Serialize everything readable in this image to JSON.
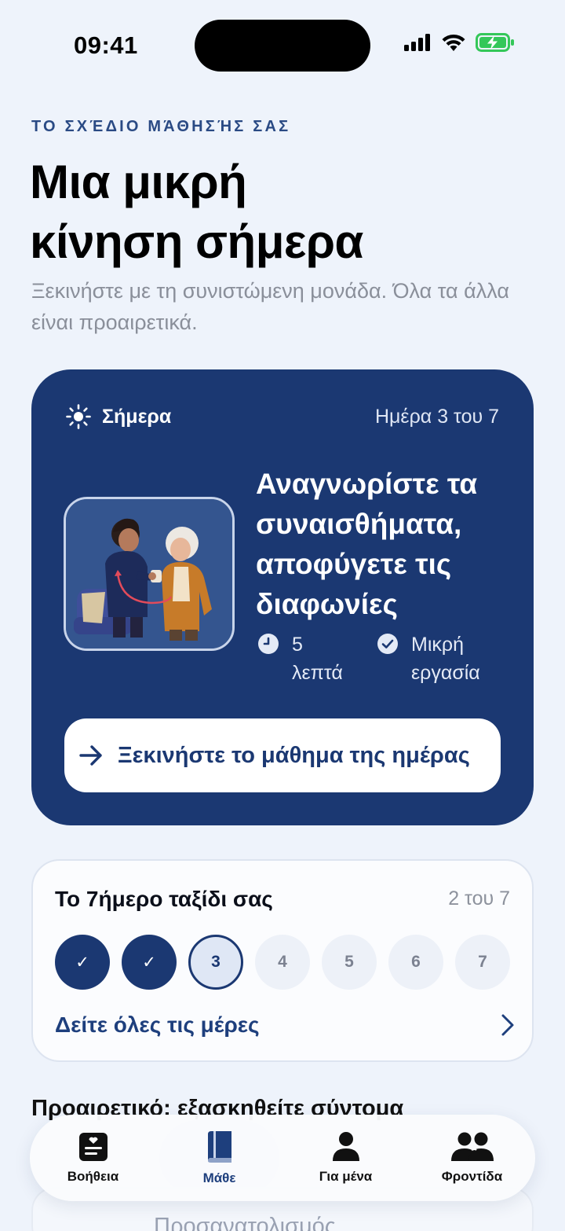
{
  "status_bar": {
    "time": "09:41"
  },
  "header": {
    "eyebrow": "ΤΟ ΣΧΈΔΙΟ ΜΆΘΗΣΉΣ ΣΑΣ",
    "title_line1": "Μια μικρή",
    "title_line2": "κίνηση σήμερα",
    "subtitle": "Ξεκινήστε με τη συνιστώμενη μονάδα. Όλα τα άλλα είναι προαιρετικά."
  },
  "today_card": {
    "label": "Σήμερα",
    "day_progress": "Ημέρα 3 του 7",
    "lesson_title": "Αναγνωρίστε τα συναισθήματα, αποφύγετε τις διαφωνίες",
    "duration": "5 λεπτά",
    "task": "Μικρή εργασία",
    "start_button": "Ξεκινήστε το μάθημα της ημέρας",
    "background_color": "#1b3872"
  },
  "journey": {
    "title": "Το 7ήμερο ταξίδι σας",
    "count": "2 του 7",
    "days": [
      {
        "label": "✓",
        "state": "done"
      },
      {
        "label": "✓",
        "state": "done"
      },
      {
        "label": "3",
        "state": "current"
      },
      {
        "label": "4",
        "state": "upcoming"
      },
      {
        "label": "5",
        "state": "upcoming"
      },
      {
        "label": "6",
        "state": "upcoming"
      },
      {
        "label": "7",
        "state": "upcoming"
      }
    ],
    "see_all": "Δείτε όλες τις μέρες"
  },
  "optional_section": {
    "title": "Προαιρετικό: εξασκηθείτε σύντομα",
    "item_text": "Προσανατολισμός"
  },
  "tab_bar": {
    "active": "learn",
    "tabs": [
      {
        "id": "help",
        "label": "Βοήθεια",
        "icon": "notebook-heart-icon"
      },
      {
        "id": "learn",
        "label": "Μάθε",
        "icon": "book-icon"
      },
      {
        "id": "me",
        "label": "Για μένα",
        "icon": "person-icon"
      },
      {
        "id": "care",
        "label": "Φροντίδα",
        "icon": "people-icon"
      }
    ]
  },
  "colors": {
    "accent": "#1b3872",
    "background": "#eef3fb",
    "battery": "#34c759"
  }
}
